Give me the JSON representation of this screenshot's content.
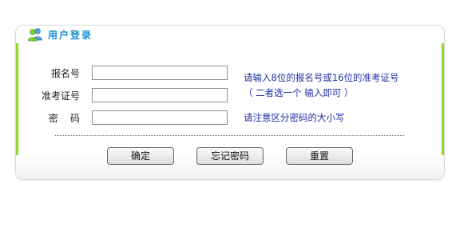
{
  "panel": {
    "title": "用户登录"
  },
  "form": {
    "fields": [
      {
        "label": "报名号",
        "value": ""
      },
      {
        "label": "准考证号",
        "value": ""
      },
      {
        "label": "密    码",
        "value": ""
      }
    ],
    "hints": {
      "line1": "请输入8位的报名号或16位的准考证号",
      "line2": "（ 二者选一个 输入即可 ）",
      "line3": "请注意区分密码的大小写"
    }
  },
  "buttons": {
    "confirm": "确定",
    "forgot": "忘记密码",
    "reset": "重置"
  },
  "colors": {
    "title": "#1a8fd6",
    "hint": "#1f2fa8",
    "accent_bar": "#8fd82f"
  },
  "icons": {
    "title_icon": "users-icon"
  }
}
